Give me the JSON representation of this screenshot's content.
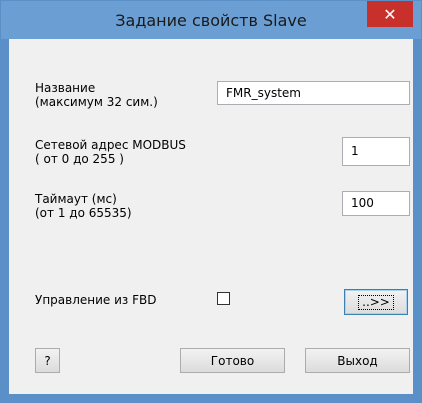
{
  "window": {
    "title": "Задание свойств Slave",
    "close_icon": "close-icon",
    "colors": {
      "titlebar": "#6b9fd4",
      "close": "#c7302b",
      "client": "#f0f0f0"
    }
  },
  "form": {
    "name": {
      "label": "Название\n(максимум 32 сим.)",
      "value": "FMR_system"
    },
    "address": {
      "label": "Сетевой адрес MODBUS\n( от 0 до 255 )",
      "value": "1"
    },
    "timeout": {
      "label": "Таймаут (мс)\n(от 1 до 65535)",
      "value": "100"
    },
    "fbd_control": {
      "label": "Управление из FBD",
      "checked": false
    },
    "more_button": "..>>"
  },
  "buttons": {
    "help": "?",
    "done": "Готово",
    "exit": "Выход"
  }
}
